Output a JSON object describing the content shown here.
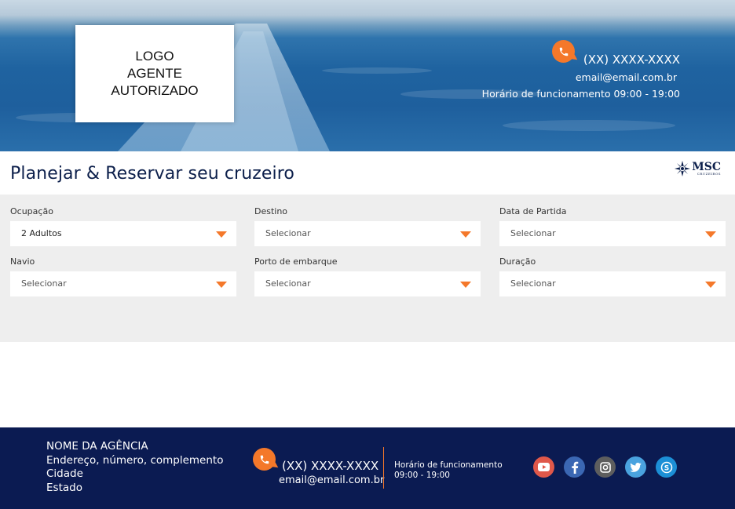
{
  "hero": {
    "logo_lines": [
      "LOGO",
      "AGENTE",
      "AUTORIZADO"
    ],
    "phone": "(XX) XXXX-XXXX",
    "email": "email@email.com.br",
    "hours": "Horário de funcionamento 09:00 - 19:00"
  },
  "header": {
    "title": "Planejar & Reservar seu cruzeiro",
    "brand": "MSC",
    "brand_sub": "CRUZEIROS"
  },
  "form": {
    "fields": [
      {
        "label": "Ocupação",
        "value": "2 Adultos"
      },
      {
        "label": "Destino",
        "value": "Selecionar"
      },
      {
        "label": "Data de Partida",
        "value": "Selecionar"
      },
      {
        "label": "Navio",
        "value": "Selecionar"
      },
      {
        "label": "Porto de embarque",
        "value": "Selecionar"
      },
      {
        "label": "Duração",
        "value": "Selecionar"
      }
    ]
  },
  "footer": {
    "agency_name": "NOME DA AGÊNCIA",
    "address": "Endereço, número, complemento",
    "city": "Cidade",
    "state": "Estado",
    "phone": "(XX) XXXX-XXXX",
    "email": "email@email.com.br",
    "hours_label": "Horário de funcionamento",
    "hours_value": "09:00 - 19:00",
    "socials": [
      "youtube-icon",
      "facebook-icon",
      "instagram-icon",
      "twitter-icon",
      "skype-icon"
    ]
  },
  "colors": {
    "accent": "#f4782a",
    "navy": "#0b1b52",
    "form_bg": "#eeeeee"
  }
}
